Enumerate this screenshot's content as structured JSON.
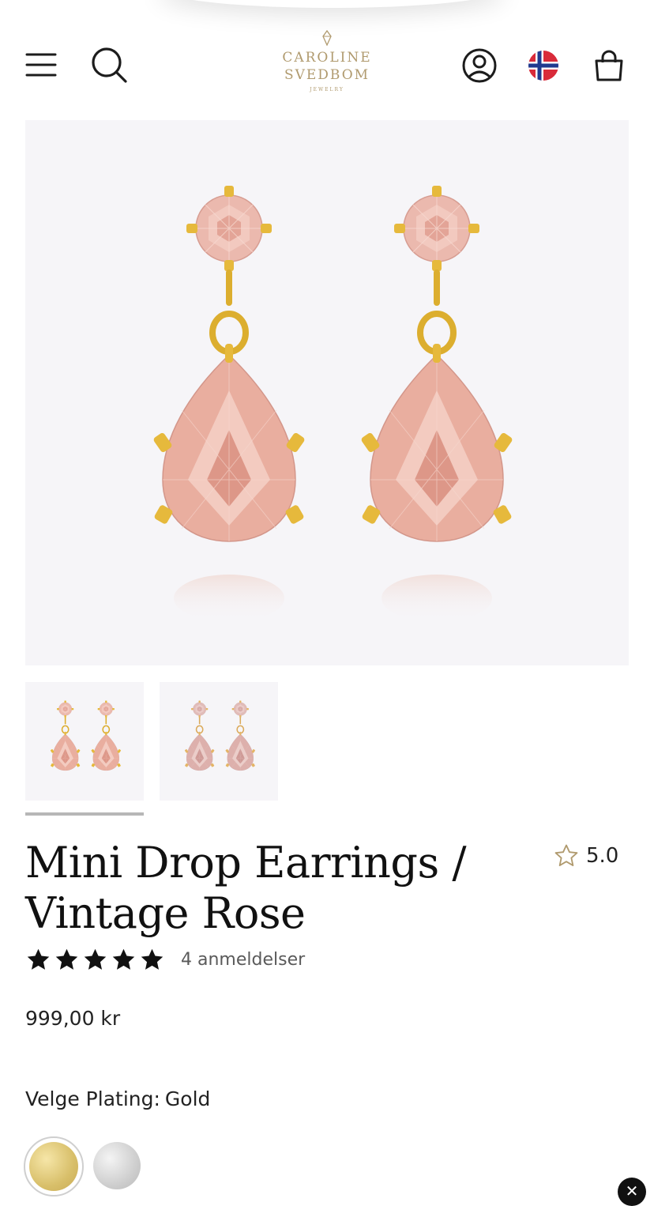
{
  "header": {
    "logo_line1": "CAROLINE",
    "logo_line2": "SVEDBOM",
    "logo_line3": "JEWELRY",
    "icons": [
      "menu-icon",
      "search-icon",
      "account-icon",
      "norway-flag-icon",
      "cart-icon"
    ]
  },
  "gallery": {
    "active_thumbnail": 1,
    "thumbnails": [
      "gold",
      "silver"
    ]
  },
  "product": {
    "title_line1": "Mini Drop Earrings /",
    "title_line2": "Vintage Rose",
    "rating_value": "5.0",
    "stars": 5,
    "reviews": "4 anmeldelser",
    "price": "999,00 kr"
  },
  "plating": {
    "label": "Velge Plating:",
    "selected": "Gold",
    "options": [
      "Gold",
      "Silver"
    ]
  },
  "colors": {
    "brand_gold": "#b09a6e",
    "stone_pink": "#e9b3a8",
    "metal_gold": "#d9ac2b"
  }
}
